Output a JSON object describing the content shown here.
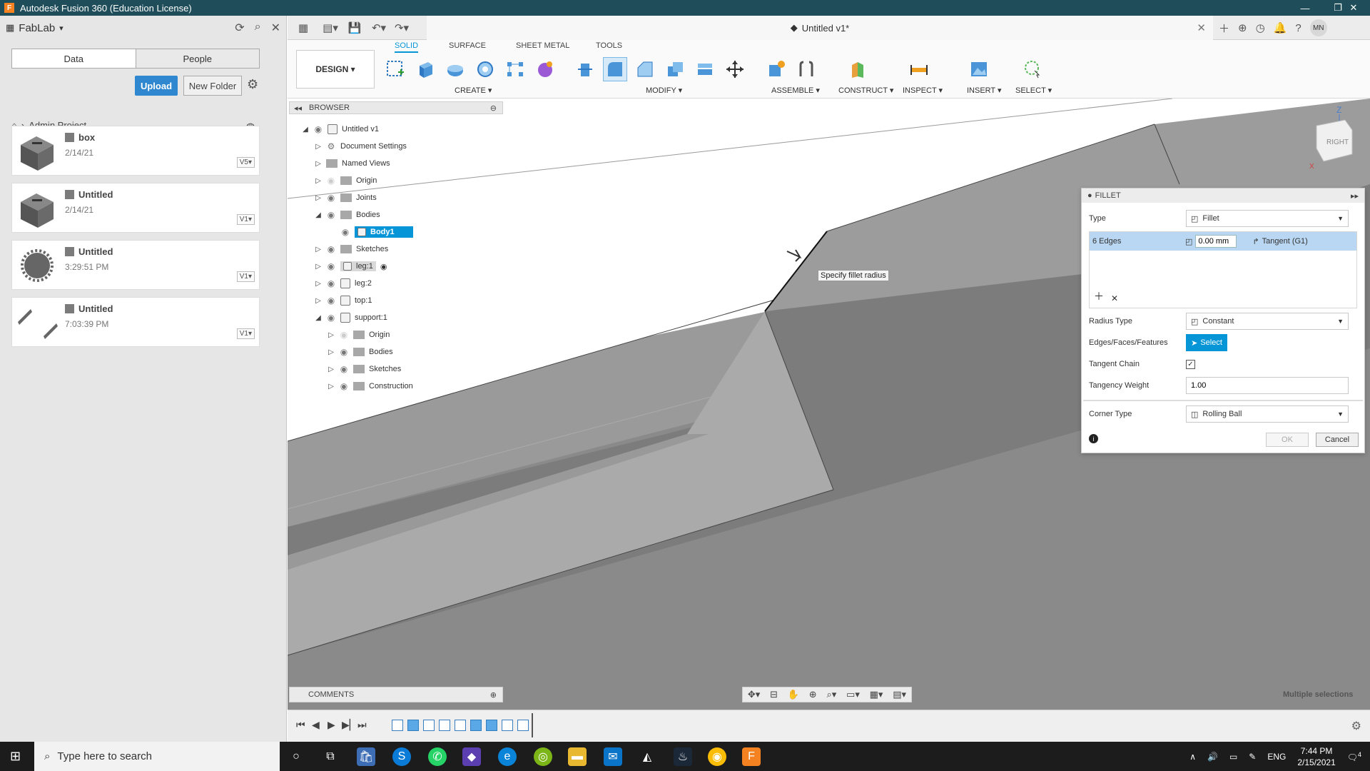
{
  "window": {
    "title": "Autodesk Fusion 360 (Education License)"
  },
  "datapanel": {
    "hub": "FabLab",
    "tabs": [
      "Data",
      "People"
    ],
    "upload": "Upload",
    "new_folder": "New Folder",
    "breadcrumb": "Admin Project",
    "files": [
      {
        "name": "box",
        "date": "2/14/21",
        "version": "V5"
      },
      {
        "name": "Untitled",
        "date": "2/14/21",
        "version": "V1"
      },
      {
        "name": "Untitled",
        "date": "3:29:51 PM",
        "version": "V1"
      },
      {
        "name": "Untitled",
        "date": "7:03:39 PM",
        "version": "V1"
      }
    ]
  },
  "doc": {
    "title": "Untitled v1*",
    "user_initials": "MN"
  },
  "ribbon": {
    "workspace": "DESIGN",
    "tabs": [
      "SOLID",
      "SURFACE",
      "SHEET METAL",
      "TOOLS"
    ],
    "groups": [
      "CREATE",
      "MODIFY",
      "ASSEMBLE",
      "CONSTRUCT",
      "INSPECT",
      "INSERT",
      "SELECT"
    ]
  },
  "browser": {
    "title": "BROWSER",
    "items": [
      {
        "label": "Untitled v1"
      },
      {
        "label": "Document Settings"
      },
      {
        "label": "Named Views"
      },
      {
        "label": "Origin"
      },
      {
        "label": "Joints"
      },
      {
        "label": "Bodies"
      },
      {
        "label": "Body1"
      },
      {
        "label": "Sketches"
      },
      {
        "label": "leg:1"
      },
      {
        "label": "leg:2"
      },
      {
        "label": "top:1"
      },
      {
        "label": "support:1"
      },
      {
        "label": "Origin"
      },
      {
        "label": "Bodies"
      },
      {
        "label": "Sketches"
      },
      {
        "label": "Construction"
      }
    ]
  },
  "tooltip": "Specify fillet radius",
  "fillet": {
    "title": "FILLET",
    "type_label": "Type",
    "type_value": "Fillet",
    "edges_label": "6 Edges",
    "radius_value": "0.00 mm",
    "continuity": "Tangent (G1)",
    "radius_type_label": "Radius Type",
    "radius_type_value": "Constant",
    "efs_label": "Edges/Faces/Features",
    "select_label": "Select",
    "tangent_chain_label": "Tangent Chain",
    "tangent_chain_checked": true,
    "tangency_weight_label": "Tangency Weight",
    "tangency_weight_value": "1.00",
    "corner_type_label": "Corner Type",
    "corner_type_value": "Rolling Ball",
    "ok": "OK",
    "cancel": "Cancel"
  },
  "comments": "COMMENTS",
  "status": "Multiple selections",
  "viewcube_label": "RIGHT",
  "taskbar": {
    "search_placeholder": "Type here to search",
    "lang": "ENG",
    "time": "7:44 PM",
    "date": "2/15/2021",
    "notifications": "4"
  }
}
